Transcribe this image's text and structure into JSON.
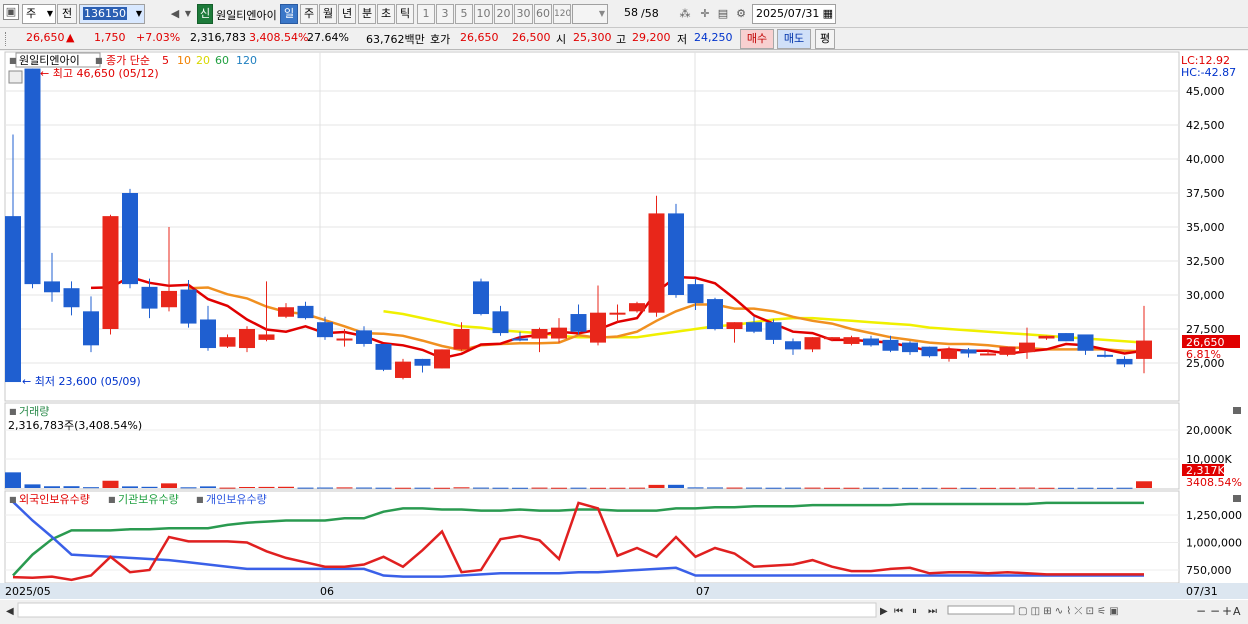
{
  "toolbar": {
    "period_select": "주",
    "prev_label": "전",
    "code": "136150",
    "badge": "신",
    "name": "원일티엔아이",
    "tabs": [
      "일",
      "주",
      "월",
      "년",
      "분",
      "초",
      "틱"
    ],
    "active_tab": "일",
    "intervals": [
      "1",
      "3",
      "5",
      "10",
      "20",
      "30",
      "60",
      "120"
    ],
    "page": "58",
    "page_total": "/58",
    "date": "2025/07/31"
  },
  "quote": {
    "price": "26,650",
    "arrow": "▲",
    "change": "1,750",
    "change_pct": "+7.03%",
    "volume": "2,316,783",
    "vol_ratio": "3,408.54%",
    "turnover": "27.64%",
    "amount": "63,762백만",
    "bid_label": "호가",
    "ask": "26,650",
    "bid": "26,500",
    "open_label": "시",
    "open": "25,300",
    "high_label": "고",
    "high": "29,200",
    "low_label": "저",
    "low": "24,250",
    "buy_label": "매수",
    "sell_label": "매도",
    "eval_label": "평"
  },
  "legend": {
    "stock": "원일티엔아이",
    "ma_label": "종가 단순",
    "ma_periods": [
      "5",
      "10",
      "20",
      "60",
      "120"
    ],
    "ma_colors": [
      "#e00000",
      "#f08000",
      "#e8e800",
      "#20a040",
      "#2080c0"
    ]
  },
  "annotations": {
    "high": "최고 46,650 (05/12)",
    "low": "최저 23,600 (05/09)",
    "lc": "LC:12.92",
    "hc": "HC:-42.87",
    "last_price": "26,650",
    "last_pct": "6.81%",
    "vol_tag": "2,317K",
    "vol_pct": "3408.54%"
  },
  "volume_panel": {
    "title": "거래량",
    "value": "2,316,783주(3,408.54%)",
    "y_ticks": [
      "20,000K",
      "10,000K"
    ]
  },
  "holdings_panel": {
    "series": [
      "외국인보유수량",
      "기관보유수량",
      "개인보유수량"
    ],
    "y_ticks": [
      "1,250,000",
      "1,000,000",
      "750,000"
    ]
  },
  "price_ticks": [
    "45,000",
    "42,500",
    "40,000",
    "37,500",
    "35,000",
    "32,500",
    "30,000",
    "27,500",
    "25,000"
  ],
  "x_labels": [
    "2025/05",
    "06",
    "07",
    "07/31"
  ],
  "chart_data": {
    "type": "candlestick",
    "candles": [
      [
        35800,
        23600,
        41800,
        23600
      ],
      [
        46650,
        30800,
        46650,
        30500
      ],
      [
        31000,
        30200,
        33100,
        29500
      ],
      [
        30500,
        29100,
        31000,
        28500
      ],
      [
        28800,
        26300,
        29900,
        25800
      ],
      [
        27500,
        35800,
        35900,
        27100
      ],
      [
        37500,
        30800,
        37800,
        30500
      ],
      [
        30600,
        29000,
        31200,
        28300
      ],
      [
        29100,
        30300,
        35000,
        28800
      ],
      [
        30400,
        27900,
        31100,
        27600
      ],
      [
        28200,
        26100,
        29200,
        25900
      ],
      [
        26200,
        26900,
        27100,
        26100
      ],
      [
        26100,
        27500,
        27700,
        25800
      ],
      [
        26700,
        27100,
        31000,
        26600
      ],
      [
        28400,
        29100,
        29400,
        28300
      ],
      [
        29200,
        28300,
        29500,
        28200
      ],
      [
        28000,
        26900,
        28400,
        26700
      ],
      [
        26800,
        26800,
        27500,
        26200
      ],
      [
        27400,
        26400,
        27700,
        26200
      ],
      [
        26400,
        24500,
        26400,
        24400
      ],
      [
        23900,
        25100,
        25300,
        23800
      ],
      [
        25300,
        24800,
        25300,
        24300
      ],
      [
        24600,
        26000,
        26000,
        24600
      ],
      [
        26000,
        27500,
        28000,
        25900
      ],
      [
        31000,
        28600,
        31200,
        28500
      ],
      [
        28800,
        27200,
        29200,
        27000
      ],
      [
        26800,
        26700,
        27300,
        26600
      ],
      [
        26800,
        27500,
        27600,
        25800
      ],
      [
        26800,
        27600,
        28300,
        26500
      ],
      [
        28600,
        27300,
        29300,
        27100
      ],
      [
        26500,
        28700,
        30700,
        26300
      ],
      [
        28600,
        28700,
        29300,
        28000
      ],
      [
        28800,
        29400,
        29500,
        28700
      ],
      [
        28700,
        36000,
        37300,
        28400
      ],
      [
        36000,
        30000,
        36700,
        29800
      ],
      [
        30800,
        29400,
        31200,
        28900
      ],
      [
        29700,
        27500,
        29800,
        27400
      ],
      [
        27500,
        28000,
        28000,
        26500
      ],
      [
        28000,
        27300,
        28400,
        27200
      ],
      [
        28000,
        26700,
        28200,
        26400
      ],
      [
        26600,
        26000,
        26800,
        25600
      ],
      [
        26000,
        26900,
        26900,
        25800
      ],
      [
        26900,
        26900,
        26900,
        26600
      ],
      [
        26400,
        26900,
        27000,
        26300
      ],
      [
        26800,
        26300,
        27000,
        26200
      ],
      [
        26700,
        25900,
        27000,
        25800
      ],
      [
        26500,
        25800,
        26600,
        25600
      ],
      [
        26200,
        25500,
        26200,
        25400
      ],
      [
        25300,
        26000,
        26200,
        25100
      ],
      [
        26000,
        25700,
        26100,
        25400
      ],
      [
        25700,
        25700,
        26000,
        25600
      ],
      [
        25600,
        26200,
        26200,
        25500
      ],
      [
        25800,
        26500,
        27600,
        25300
      ],
      [
        26800,
        27000,
        27000,
        26700
      ],
      [
        27200,
        26600,
        27200,
        26600
      ],
      [
        27100,
        25900,
        27100,
        25600
      ],
      [
        25600,
        25500,
        25900,
        25400
      ],
      [
        25300,
        24900,
        25500,
        24700
      ],
      [
        25300,
        26650,
        29200,
        24250
      ]
    ],
    "volume_k": [
      5400,
      1250,
      600,
      620,
      280,
      2500,
      560,
      410,
      1600,
      240,
      560,
      130,
      350,
      380,
      420,
      130,
      160,
      210,
      160,
      110,
      90,
      110,
      80,
      240,
      140,
      100,
      80,
      130,
      90,
      110,
      80,
      90,
      120,
      1080,
      1100,
      210,
      190,
      150,
      140,
      100,
      120,
      130,
      80,
      90,
      100,
      80,
      70,
      80,
      80,
      70,
      60,
      80,
      150,
      80,
      70,
      90,
      70,
      90,
      2317
    ],
    "ma5": [
      null,
      null,
      null,
      null,
      30520,
      30560,
      31320,
      30900,
      30680,
      30740,
      29700,
      29200,
      28200,
      27460,
      27300,
      27700,
      27200,
      27280,
      26980,
      26450,
      26300,
      25960,
      25360,
      25680,
      26360,
      26420,
      26900,
      27060,
      27300,
      27180,
      27460,
      28020,
      28300,
      30220,
      31320,
      31260,
      30860,
      29740,
      28500,
      27900,
      27300,
      27200,
      26700,
      26700,
      26600,
      26500,
      26200,
      25900,
      26000,
      25900,
      25900,
      25700,
      25850,
      26000,
      26400,
      26300,
      26000,
      25700,
      25900
    ],
    "ma10": [
      null,
      null,
      null,
      null,
      null,
      null,
      null,
      null,
      null,
      30500,
      30550,
      30050,
      29750,
      29150,
      28750,
      28600,
      28150,
      27700,
      27200,
      27150,
      27000,
      26650,
      26250,
      25950,
      26300,
      26400,
      26450,
      26450,
      26500,
      27050,
      26850,
      26950,
      27300,
      28100,
      28800,
      29300,
      29300,
      29000,
      29000,
      28800,
      28400,
      28100,
      27900,
      27500,
      27200,
      26900,
      26700,
      26500,
      26400,
      26400,
      26300,
      26150,
      26100,
      26000,
      26000,
      26000,
      26000,
      25900,
      25850
    ],
    "ma20": [
      null,
      null,
      null,
      null,
      null,
      null,
      null,
      null,
      null,
      null,
      null,
      null,
      null,
      null,
      null,
      null,
      null,
      null,
      null,
      28800,
      28600,
      28300,
      28000,
      27700,
      27600,
      27400,
      27300,
      27200,
      27000,
      26900,
      26900,
      26900,
      26900,
      27100,
      27300,
      27500,
      27700,
      27800,
      28000,
      28200,
      28300,
      28300,
      28200,
      28100,
      28000,
      27900,
      27800,
      27600,
      27500,
      27400,
      27300,
      27200,
      27100,
      27000,
      26900,
      26800,
      26700,
      26600,
      26500
    ],
    "foreign": [
      685000,
      680000,
      690000,
      660000,
      700000,
      870000,
      730000,
      750000,
      1050000,
      1010000,
      1010000,
      1010000,
      1000000,
      920000,
      860000,
      820000,
      780000,
      780000,
      800000,
      870000,
      780000,
      930000,
      1100000,
      730000,
      750000,
      1030000,
      1060000,
      1020000,
      850000,
      1360000,
      1310000,
      880000,
      950000,
      870000,
      1050000,
      870000,
      950000,
      900000,
      780000,
      790000,
      800000,
      840000,
      780000,
      740000,
      740000,
      760000,
      770000,
      720000,
      730000,
      730000,
      720000,
      730000,
      720000,
      710000,
      710000,
      710000,
      710000,
      710000,
      710000
    ],
    "institution": [
      700000,
      890000,
      1030000,
      1110000,
      1110000,
      1110000,
      1120000,
      1120000,
      1130000,
      1130000,
      1130000,
      1160000,
      1180000,
      1190000,
      1200000,
      1200000,
      1200000,
      1220000,
      1220000,
      1280000,
      1310000,
      1310000,
      1300000,
      1300000,
      1290000,
      1290000,
      1300000,
      1290000,
      1290000,
      1300000,
      1300000,
      1290000,
      1290000,
      1290000,
      1310000,
      1310000,
      1320000,
      1320000,
      1330000,
      1330000,
      1330000,
      1340000,
      1340000,
      1340000,
      1340000,
      1340000,
      1350000,
      1350000,
      1350000,
      1350000,
      1350000,
      1350000,
      1350000,
      1360000,
      1360000,
      1360000,
      1360000,
      1360000,
      1360000
    ],
    "individual": [
      1370000,
      1200000,
      1050000,
      890000,
      880000,
      870000,
      860000,
      850000,
      840000,
      820000,
      800000,
      780000,
      760000,
      760000,
      760000,
      760000,
      760000,
      760000,
      760000,
      700000,
      690000,
      690000,
      690000,
      700000,
      710000,
      720000,
      720000,
      720000,
      720000,
      730000,
      730000,
      740000,
      750000,
      760000,
      770000,
      700000,
      700000,
      700000,
      700000,
      700000,
      700000,
      700000,
      700000,
      700000,
      700000,
      700000,
      700000,
      700000,
      700000,
      700000,
      700000,
      700000,
      700000,
      700000,
      700000,
      700000,
      700000,
      700000,
      700000
    ]
  }
}
